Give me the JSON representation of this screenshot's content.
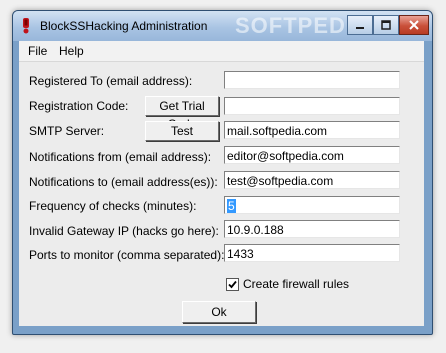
{
  "window": {
    "title": "BlockSSHacking Administration",
    "watermark": "SOFTPEDIA"
  },
  "menu": {
    "file": "File",
    "help": "Help"
  },
  "form": {
    "registered_to": {
      "label": "Registered To (email address):",
      "value": ""
    },
    "registration_code": {
      "label": "Registration Code:",
      "button": "Get Trial Code",
      "value": ""
    },
    "smtp_server": {
      "label": "SMTP Server:",
      "button": "Test",
      "value": "mail.softpedia.com"
    },
    "notifications_from": {
      "label": "Notifications from (email address):",
      "value": "editor@softpedia.com"
    },
    "notifications_to": {
      "label": "Notifications to (email address(es)):",
      "value": "test@softpedia.com"
    },
    "frequency": {
      "label": "Frequency of checks (minutes):",
      "value": "5"
    },
    "invalid_gateway": {
      "label": "Invalid Gateway IP (hacks go here):",
      "value": "10.9.0.188"
    },
    "ports": {
      "label": "Ports to monitor (comma separated):",
      "value": "1433"
    },
    "firewall_rules": {
      "label": "Create firewall rules",
      "checked": true
    }
  },
  "ok_button": "Ok",
  "icons": {
    "app": "exclamation-icon",
    "minimize": "minimize-icon",
    "maximize": "maximize-icon",
    "close": "close-icon"
  },
  "colors": {
    "titlebar": "#a9c4e3",
    "close_button": "#c9503a",
    "selection": "#3399ff"
  }
}
